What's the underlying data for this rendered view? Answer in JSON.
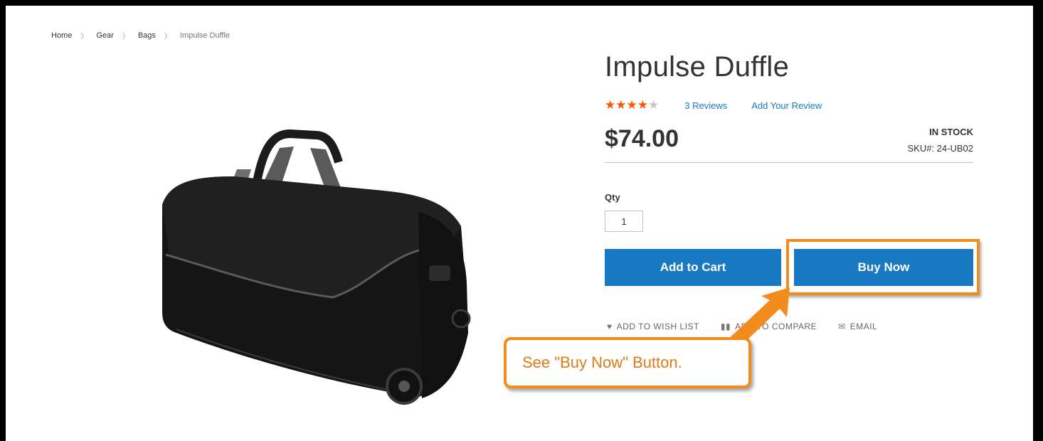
{
  "breadcrumb": [
    "Home",
    "Gear",
    "Bags",
    "Impulse Duffle"
  ],
  "product": {
    "title": "Impulse Duffle",
    "rating": 4,
    "rating_max": 5,
    "reviews_label": "3 Reviews",
    "add_review_label": "Add Your Review",
    "price": "$74.00",
    "stock": "IN STOCK",
    "sku": "SKU#:  24-UB02"
  },
  "qty": {
    "label": "Qty",
    "value": "1"
  },
  "buttons": {
    "add_to_cart": "Add to Cart",
    "buy_now": "Buy Now"
  },
  "actions": {
    "wishlist": "ADD TO WISH LIST",
    "compare": "ADD TO COMPARE",
    "email": "EMAIL"
  },
  "annotation": {
    "text": "See \"Buy Now\" Button."
  },
  "colors": {
    "accent": "#1979c3",
    "star": "#ff5501",
    "highlight": "#f28c1c"
  }
}
